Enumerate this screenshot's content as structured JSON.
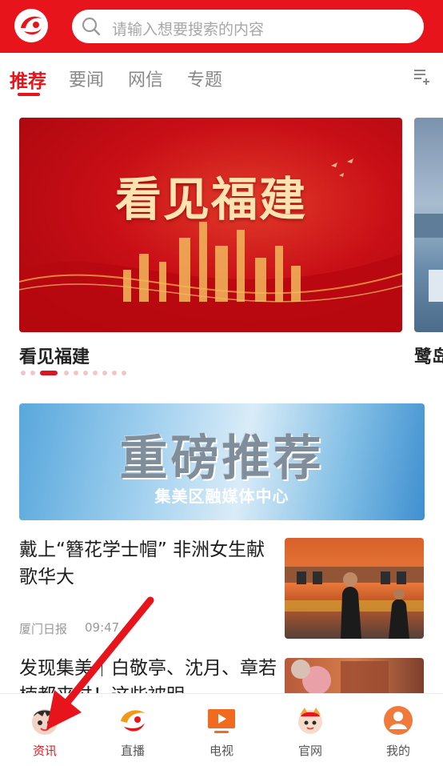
{
  "search": {
    "placeholder": "请输入想要搜索的内容"
  },
  "tabs": [
    {
      "label": "推荐"
    },
    {
      "label": "要闻"
    },
    {
      "label": "网信"
    },
    {
      "label": "专题"
    }
  ],
  "carousel": {
    "slides": [
      {
        "art_title": "看见福建",
        "caption": "看见福建"
      },
      {
        "caption": "鹭岛"
      }
    ],
    "dot_count": 10,
    "active_dot": 3
  },
  "banner": {
    "title": "重磅推荐",
    "subtitle": "集美区融媒体中心"
  },
  "articles": [
    {
      "title": "戴上“簪花学士帽” 非洲女生献歌华大",
      "source": "厦门日报",
      "time": "09:47"
    },
    {
      "title": "发现集美｜白敬亭、沈月、章若楠都来过！这些被明"
    }
  ],
  "bottom_nav": [
    {
      "label": "资讯",
      "icon": "mascot-icon",
      "active": true
    },
    {
      "label": "直播",
      "icon": "live-logo-icon"
    },
    {
      "label": "电视",
      "icon": "tv-play-icon"
    },
    {
      "label": "官网",
      "icon": "mascot-official-icon"
    },
    {
      "label": "我的",
      "icon": "user-profile-icon"
    }
  ],
  "colors": {
    "brand": "#e8141b",
    "tab_inactive": "#888888",
    "arrow": "#e8141b"
  }
}
